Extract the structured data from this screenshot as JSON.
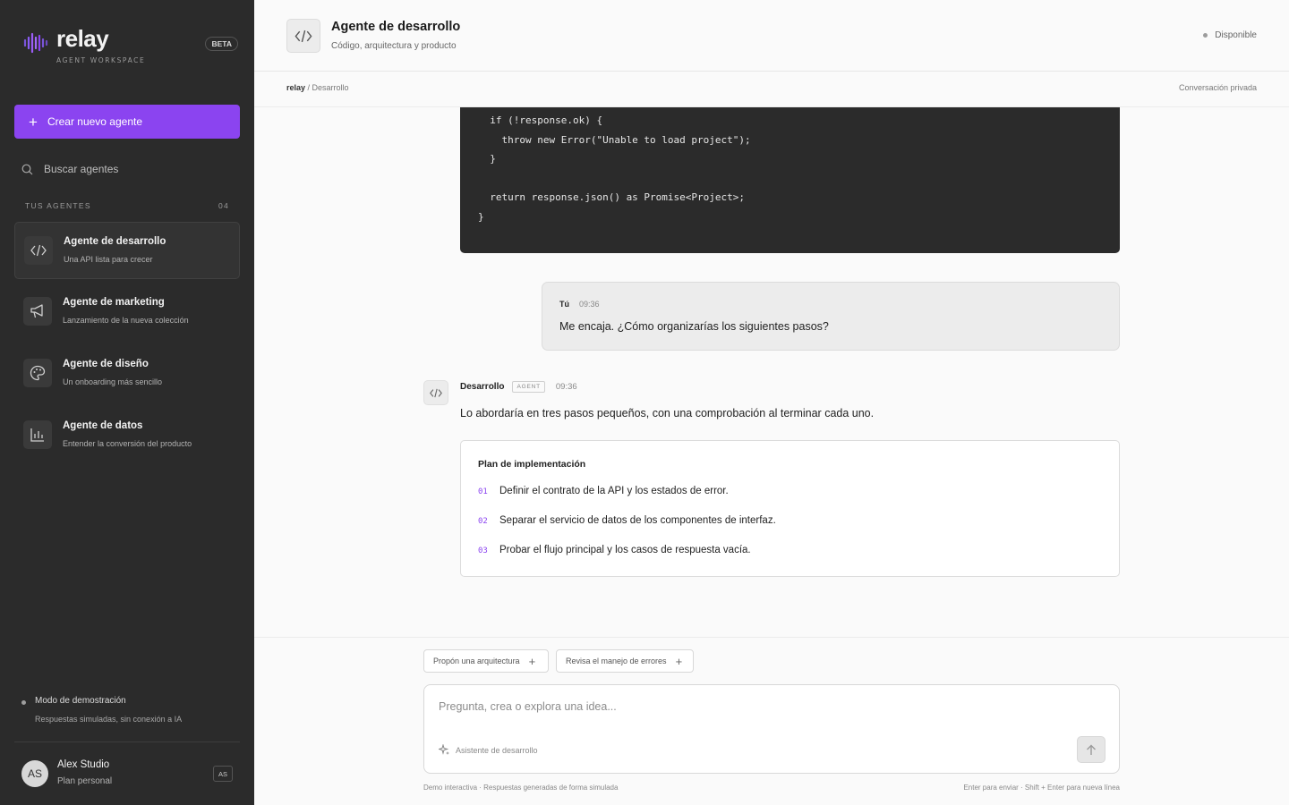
{
  "brand": {
    "name": "relay",
    "subtitle": "AGENT WORKSPACE",
    "badge": "BETA",
    "accent": "#8b44f0"
  },
  "sidebar": {
    "new_agent_label": "Crear nuevo agente",
    "search_placeholder": "Buscar agentes",
    "section_label": "TUS AGENTES",
    "section_count": "04",
    "agents": [
      {
        "name": "Agente de desarrollo",
        "desc": "Una API lista para crecer",
        "icon": "code-icon",
        "active": true
      },
      {
        "name": "Agente de marketing",
        "desc": "Lanzamiento de la nueva colección",
        "icon": "megaphone-icon"
      },
      {
        "name": "Agente de diseño",
        "desc": "Un onboarding más sencillo",
        "icon": "palette-icon"
      },
      {
        "name": "Agente de datos",
        "desc": "Entender la conversión del producto",
        "icon": "bar-chart-icon"
      }
    ],
    "demo": {
      "title": "Modo de demostración",
      "desc": "Respuestas simuladas, sin conexión a IA"
    },
    "user": {
      "initials": "AS",
      "name": "Alex Studio",
      "plan": "Plan personal",
      "chip": "AS"
    }
  },
  "header": {
    "title": "Agente de desarrollo",
    "subtitle": "Código, arquitectura y producto",
    "status": "Disponible",
    "crumb_root": "relay",
    "crumb_rest": " / Desarrollo",
    "privacy": "Conversación privada"
  },
  "chat": {
    "code_lines": [
      "  if (!response.ok) {",
      "    throw new Error(\"Unable to load project\");",
      "  }",
      "",
      "  return response.json() as Promise<Project>;",
      "}"
    ],
    "user_message": {
      "author": "Tú",
      "time": "09:36",
      "text": "Me encaja. ¿Cómo organizarías los siguientes pasos?"
    },
    "agent_message": {
      "author": "Desarrollo",
      "tag": "AGENT",
      "time": "09:36",
      "text": "Lo abordaría en tres pasos pequeños, con una comprobación al terminar cada uno.",
      "plan_title": "Plan de implementación",
      "steps": [
        {
          "num": "01",
          "text": "Definir el contrato de la API y los estados de error."
        },
        {
          "num": "02",
          "text": "Separar el servicio de datos de los componentes de interfaz."
        },
        {
          "num": "03",
          "text": "Probar el flujo principal y los casos de respuesta vacía."
        }
      ]
    }
  },
  "composer": {
    "suggestions": [
      "Propón una arquitectura",
      "Revisa el manejo de errores"
    ],
    "placeholder": "Pregunta, crea o explora una idea...",
    "assistant_label": "Asistente de desarrollo",
    "footer_left": "Demo interactiva · Respuestas generadas de forma simulada",
    "footer_right": "Enter para enviar · Shift + Enter para nueva línea"
  }
}
